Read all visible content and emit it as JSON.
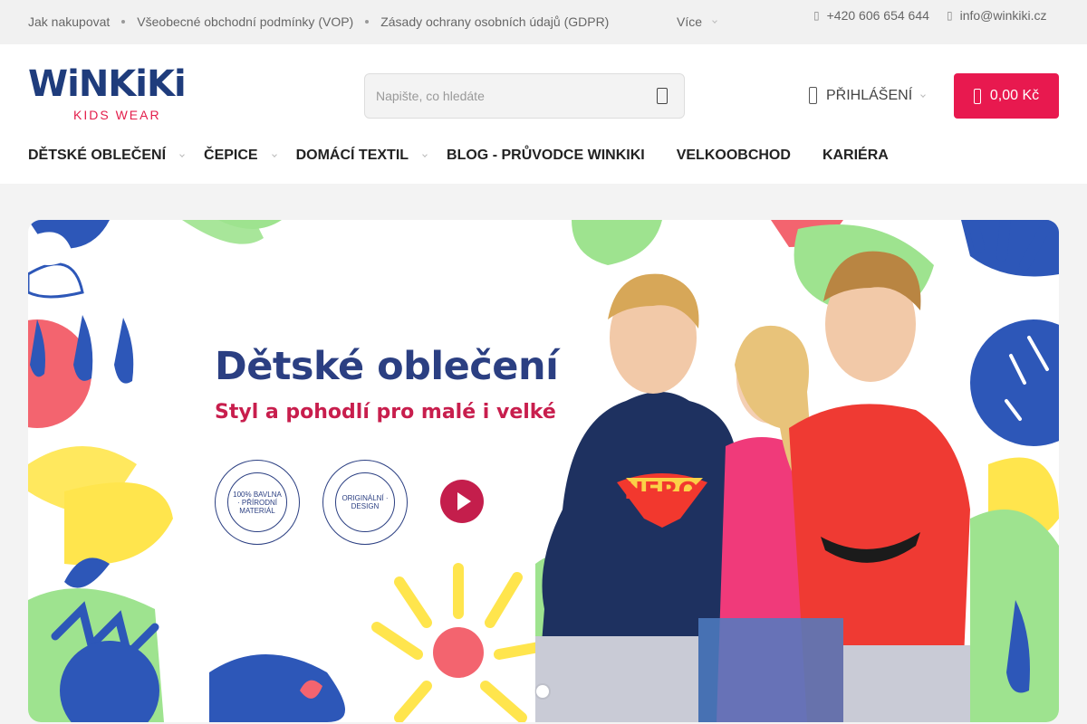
{
  "topbar": {
    "links": [
      "Jak nakupovat",
      "Všeobecné obchodní podmínky (VOP)",
      "Zásady ochrany osobních údajů (GDPR)"
    ],
    "more_label": "Více",
    "phone": "+420 606 654 644",
    "email": "info@winkiki.cz"
  },
  "header": {
    "logo_text": "WiNKiKi",
    "logo_tagline": "KIDS WEAR",
    "search_placeholder": "Napište, co hledáte",
    "login_label": "PŘIHLÁŠENÍ",
    "cart_total": "0,00 Kč"
  },
  "nav": {
    "items": [
      {
        "label": "DĚTSKÉ OBLEČENÍ",
        "has_dropdown": true
      },
      {
        "label": "ČEPICE",
        "has_dropdown": true
      },
      {
        "label": "DOMÁCÍ TEXTIL",
        "has_dropdown": true
      },
      {
        "label": "BLOG - PRŮVODCE WINKIKI",
        "has_dropdown": false
      },
      {
        "label": "VELKOOBCHOD",
        "has_dropdown": false
      },
      {
        "label": "KARIÉRA",
        "has_dropdown": false
      }
    ]
  },
  "hero": {
    "title": "Dětské oblečení",
    "subtitle": "Styl a pohodlí pro malé i velké",
    "badges": [
      {
        "text": "100% BAVLNA · PŘÍRODNÍ MATERIÁL"
      },
      {
        "text": "ORIGINÁLNÍ · DESIGN"
      }
    ],
    "shirt_print": "HERO"
  },
  "colors": {
    "brand_blue": "#1f3c7c",
    "brand_red": "#e8194f",
    "topbar_bg": "#f1f1f1"
  }
}
